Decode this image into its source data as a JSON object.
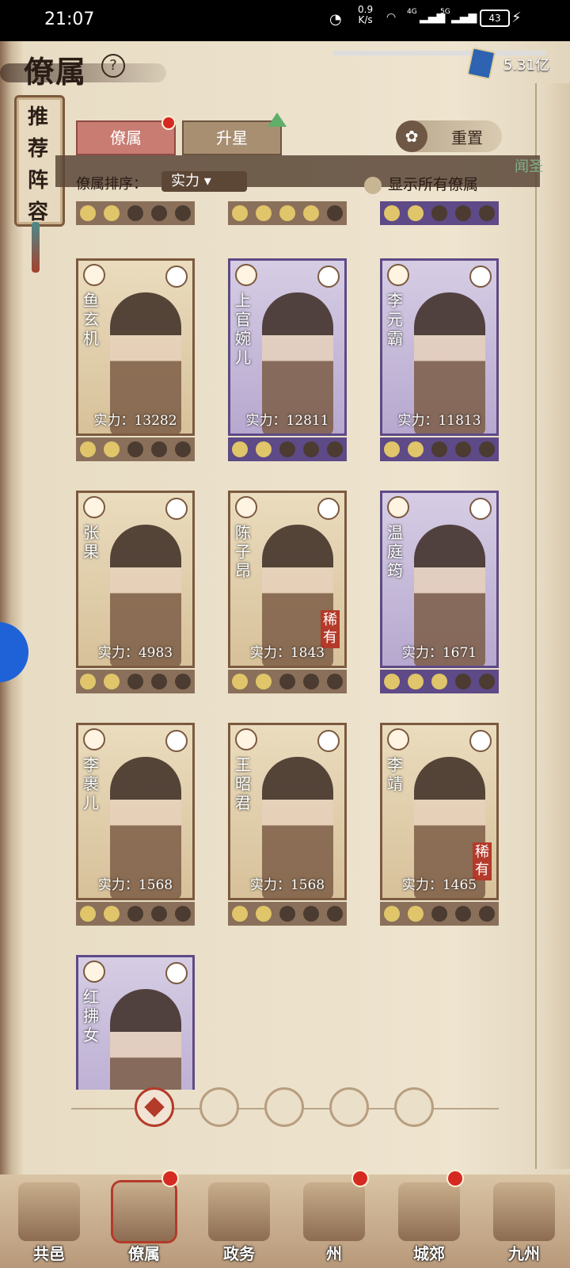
{
  "status_bar": {
    "time": "21:07",
    "net_speed": "0.9",
    "net_unit": "K/s",
    "sig1": "4G",
    "sig2": "5G",
    "battery": "43"
  },
  "header": {
    "title": "僚属",
    "help": "?",
    "currency": "5.31亿"
  },
  "side_banner": {
    "chars": [
      "推",
      "荐",
      "阵",
      "容"
    ]
  },
  "tabs": [
    {
      "label": "僚属"
    },
    {
      "label": "升星"
    }
  ],
  "reset_label": "重置",
  "sort": {
    "label": "僚属排序：",
    "value": "实力"
  },
  "show_all_label": "显示所有僚属",
  "side_peek": "闻圣",
  "partial_cards": [
    {
      "theme": "brown",
      "stars": 2
    },
    {
      "theme": "brown",
      "stars": 4
    },
    {
      "theme": "purple",
      "stars": 2
    }
  ],
  "cards": [
    {
      "name": "鱼玄机",
      "power": "实力：13282",
      "theme": "brown",
      "stars": 2,
      "rare": ""
    },
    {
      "name": "上官婉儿",
      "power": "实力：12811",
      "theme": "purple",
      "stars": 2,
      "rare": ""
    },
    {
      "name": "李元霸",
      "power": "实力：11813",
      "theme": "purple",
      "stars": 2,
      "rare": ""
    },
    {
      "name": "张果",
      "power": "实力：4983",
      "theme": "brown",
      "stars": 2,
      "rare": ""
    },
    {
      "name": "陈子昂",
      "power": "实力：1843",
      "theme": "brown",
      "stars": 2,
      "rare": "稀有"
    },
    {
      "name": "温庭筠",
      "power": "实力：1671",
      "theme": "purple",
      "stars": 3,
      "rare": ""
    },
    {
      "name": "李裹儿",
      "power": "实力：1568",
      "theme": "brown",
      "stars": 2,
      "rare": ""
    },
    {
      "name": "王昭君",
      "power": "实力：1568",
      "theme": "brown",
      "stars": 2,
      "rare": ""
    },
    {
      "name": "李靖",
      "power": "实力：1465",
      "theme": "brown",
      "stars": 2,
      "rare": "稀有"
    },
    {
      "name": "红拂女",
      "power": "",
      "theme": "purple",
      "stars": 0,
      "rare": ""
    }
  ],
  "filters": [
    {
      "name": "all"
    },
    {
      "name": "bell"
    },
    {
      "name": "cat"
    },
    {
      "name": "fan"
    },
    {
      "name": "lion"
    }
  ],
  "nav": [
    {
      "label": "共邑",
      "active": false,
      "dot": false
    },
    {
      "label": "僚属",
      "active": true,
      "dot": true
    },
    {
      "label": "政务",
      "active": false,
      "dot": false
    },
    {
      "label": "州",
      "active": false,
      "dot": true
    },
    {
      "label": "城郊",
      "active": false,
      "dot": true
    },
    {
      "label": "九州",
      "active": false,
      "dot": false
    }
  ]
}
